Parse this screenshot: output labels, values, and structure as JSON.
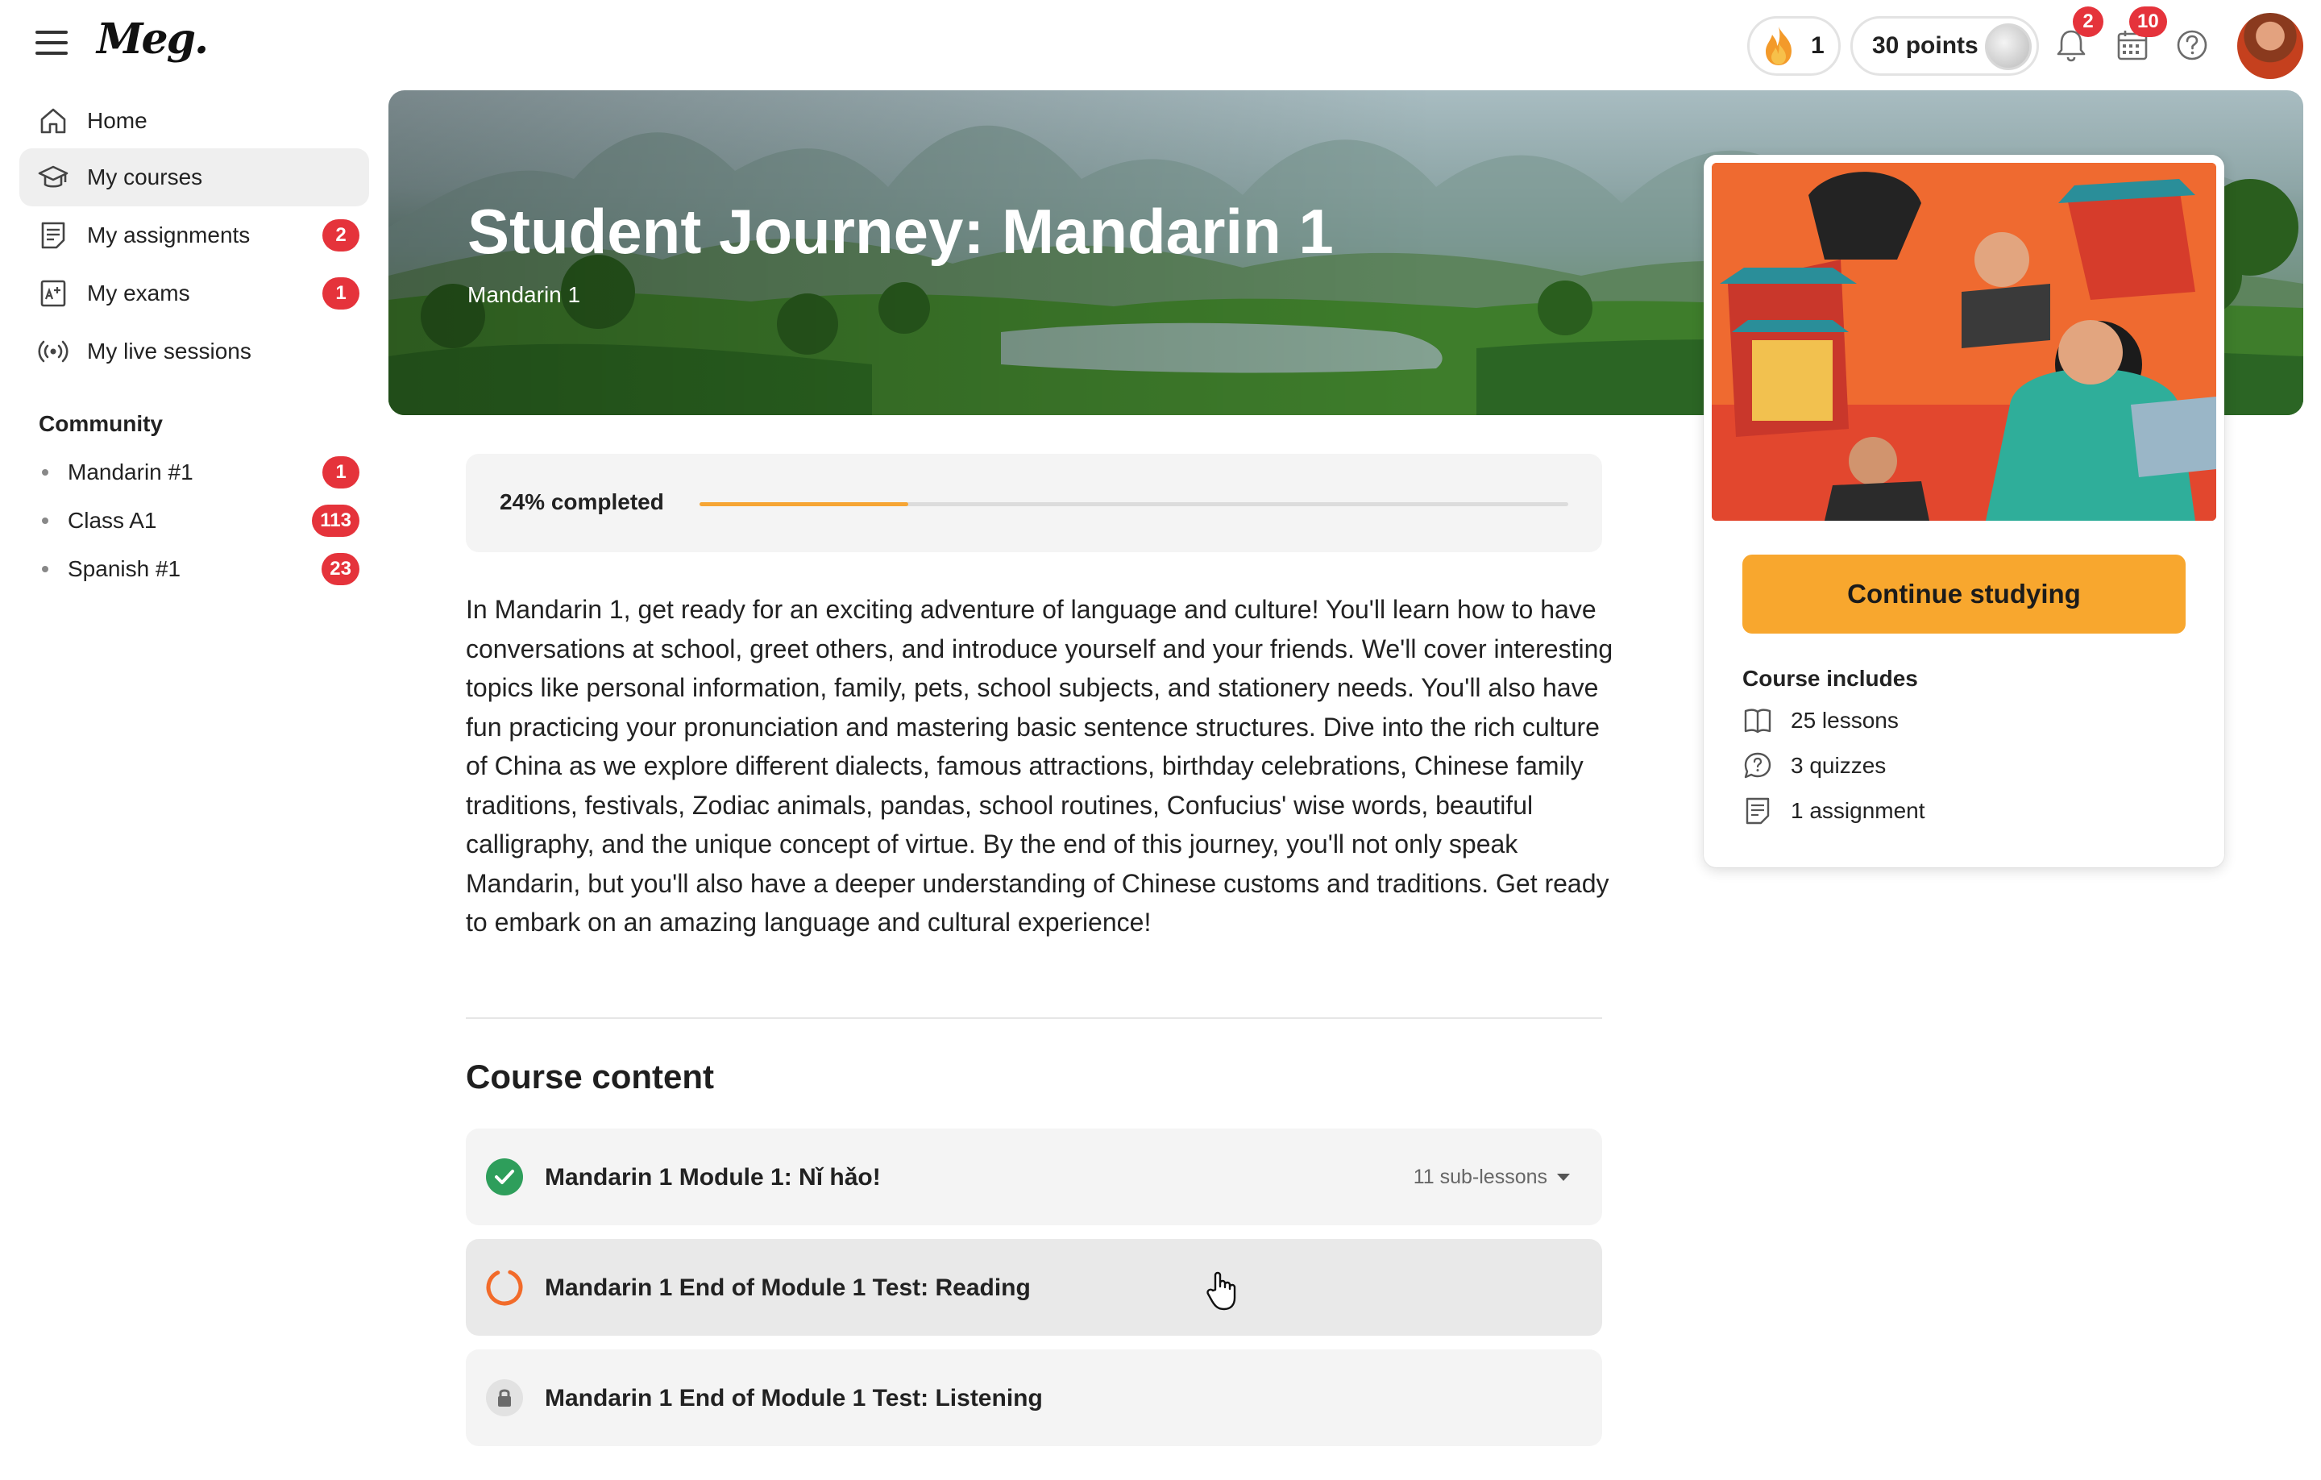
{
  "app": {
    "logo": "Meg."
  },
  "header": {
    "streak_count": "1",
    "points_label": "30 points",
    "notifications_count": "2",
    "calendar_count": "10"
  },
  "sidebar": {
    "items": [
      {
        "label": "Home",
        "icon": "home-icon",
        "badge": ""
      },
      {
        "label": "My courses",
        "icon": "graduation-cap-icon",
        "badge": "",
        "active": true
      },
      {
        "label": "My assignments",
        "icon": "assignment-icon",
        "badge": "2"
      },
      {
        "label": "My exams",
        "icon": "exam-icon",
        "badge": "1"
      },
      {
        "label": "My live sessions",
        "icon": "broadcast-icon",
        "badge": ""
      }
    ],
    "community_title": "Community",
    "community": [
      {
        "label": "Mandarin #1",
        "badge": "1"
      },
      {
        "label": "Class A1",
        "badge": "113"
      },
      {
        "label": "Spanish #1",
        "badge": "23"
      }
    ]
  },
  "hero": {
    "title": "Student Journey: Mandarin 1",
    "subtitle": "Mandarin 1"
  },
  "progress": {
    "label": "24% completed",
    "percent": 24,
    "color": "#f6a534"
  },
  "description": "In Mandarin 1, get ready for an exciting adventure of language and culture! You'll learn how to have conversations at school, greet others, and introduce yourself and your friends. We'll cover interesting topics like personal information, family, pets, school subjects, and stationery needs. You'll also have fun practicing your pronunciation and mastering basic sentence structures. Dive into the rich culture of China as we explore different dialects, famous attractions, birthday celebrations, Chinese family traditions, festivals, Zodiac animals, pandas, school routines, Confucius' wise words, beautiful calligraphy, and the unique concept of virtue. By the end of this journey, you'll not only speak Mandarin, but you'll also have a deeper understanding of Chinese customs and traditions. Get ready to embark on an amazing language and cultural experience!",
  "course_content": {
    "title": "Course content",
    "lessons": [
      {
        "title": "Mandarin 1 Module 1: Nǐ hǎo!",
        "status": "completed",
        "sub_lessons": "11 sub-lessons"
      },
      {
        "title": "Mandarin 1 End of Module 1 Test: Reading",
        "status": "in-progress",
        "sub_lessons": ""
      },
      {
        "title": "Mandarin 1 End of Module 1 Test: Listening",
        "status": "locked",
        "sub_lessons": ""
      }
    ]
  },
  "course_card": {
    "button_label": "Continue studying",
    "includes_title": "Course includes",
    "includes": [
      {
        "label": "25 lessons",
        "icon": "book-icon"
      },
      {
        "label": "3 quizzes",
        "icon": "quiz-icon"
      },
      {
        "label": "1 assignment",
        "icon": "assignment-icon"
      }
    ]
  },
  "colors": {
    "accent": "#f8a72e",
    "badge": "#e5333b",
    "success": "#2e9e5b",
    "in_progress": "#f26b2a"
  }
}
